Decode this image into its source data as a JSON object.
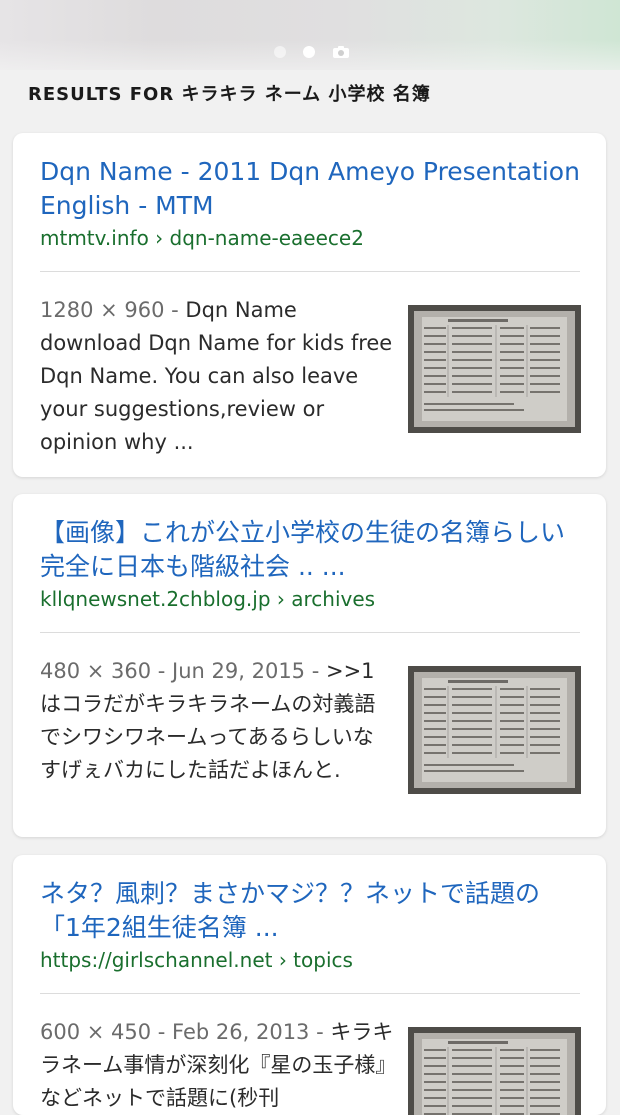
{
  "header": {
    "heading": "RESULTS FOR キラキラ ネーム 小学校 名簿",
    "page_dots": 2,
    "active_dot": 2,
    "camera_icon": "camera-icon"
  },
  "results": [
    {
      "title": "Dqn Name - 2011 Dqn Ameyo Presentation English - MTM",
      "url": "mtmtv.info › dqn-name-eaeece2",
      "meta": "1280 × 960 - ",
      "snippet": "Dqn Name download Dqn Name for kids free Dqn Name. You can also leave your suggestions,review or opinion why ..."
    },
    {
      "title": "【画像】これが公立小学校の生徒の名簿らしい 完全に日本も階級社会 .. ...",
      "url": "kllqnewsnet.2chblog.jp › archives",
      "meta": "480 × 360 - Jun 29, 2015 - ",
      "snippet": ">>1はコラだがキラキラネームの対義語でシワシワネームってあるらしいな すげぇバカにした話だよほんと."
    },
    {
      "title": "ネタ？風刺？まさかマジ？？ネットで話題の「1年2組生徒名簿 ...",
      "url": "https://girlschannel.net › topics",
      "meta": "600 × 450 - Feb 26, 2013 - ",
      "snippet": "キラキラネーム事情が深刻化『星の玉子様』などネットで話題に(秒刊"
    }
  ],
  "colors": {
    "title_link": "#1f66bd",
    "url_green": "#1a6f2e",
    "meta_gray": "#6b6b6b",
    "background": "#f1f1f1"
  }
}
